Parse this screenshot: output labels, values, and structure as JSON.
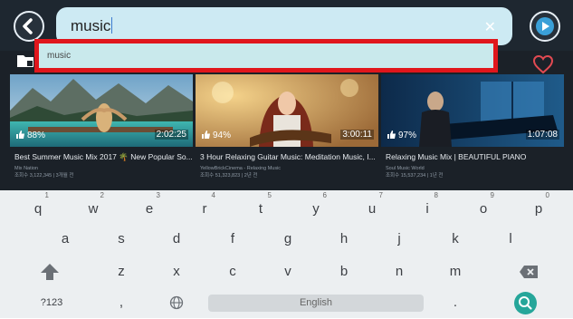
{
  "search": {
    "query": "music",
    "clear_icon": "close-icon"
  },
  "suggestions": [
    "music"
  ],
  "cards": [
    {
      "likes": "88%",
      "duration": "2:02:25",
      "title": "Best Summer Music Mix 2017 🌴 New Popular So...",
      "channel": "Mix Nation",
      "stats": "조회수 3,122,345  |  3개월 전"
    },
    {
      "likes": "94%",
      "duration": "3:00:11",
      "title": "3 Hour Relaxing Guitar Music: Meditation Music, I...",
      "channel": "YellowBrickCinema - Relaxing Music",
      "stats": "조회수 51,323,823  |  2년 전"
    },
    {
      "likes": "97%",
      "duration": "1:07:08",
      "title": "Relaxing Music Mix | BEAUTIFUL PIANO",
      "channel": "Soul Music World",
      "stats": "조회수 15,537,234  |  1년 전"
    }
  ],
  "keyboard": {
    "row1": [
      {
        "key": "q",
        "num": "1"
      },
      {
        "key": "w",
        "num": "2"
      },
      {
        "key": "e",
        "num": "3"
      },
      {
        "key": "r",
        "num": "4"
      },
      {
        "key": "t",
        "num": "5"
      },
      {
        "key": "y",
        "num": "6"
      },
      {
        "key": "u",
        "num": "7"
      },
      {
        "key": "i",
        "num": "8"
      },
      {
        "key": "o",
        "num": "9"
      },
      {
        "key": "p",
        "num": "0"
      }
    ],
    "row2": [
      "a",
      "s",
      "d",
      "f",
      "g",
      "h",
      "j",
      "k",
      "l"
    ],
    "row3": [
      "z",
      "x",
      "c",
      "v",
      "b",
      "n",
      "m"
    ],
    "symbols_label": "?123",
    "comma": ",",
    "space_label": "English",
    "period": "."
  }
}
